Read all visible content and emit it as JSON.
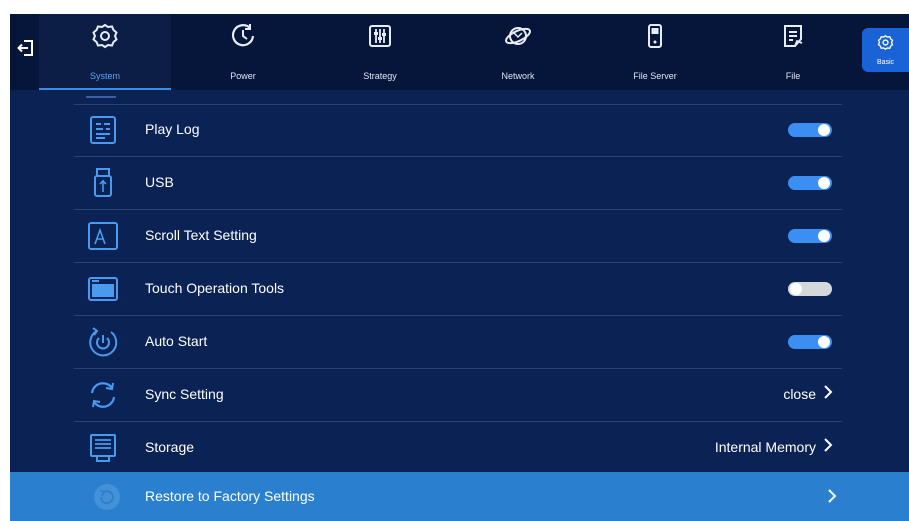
{
  "nav": {
    "tabs": [
      {
        "label": "System",
        "icon": "gear-icon",
        "active": true
      },
      {
        "label": "Power",
        "icon": "power-clock-icon",
        "active": false
      },
      {
        "label": "Strategy",
        "icon": "sliders-icon",
        "active": false
      },
      {
        "label": "Network",
        "icon": "globe-icon",
        "active": false
      },
      {
        "label": "File Server",
        "icon": "server-icon",
        "active": false
      },
      {
        "label": "File",
        "icon": "document-icon",
        "active": false
      }
    ],
    "basic_label": "Basic"
  },
  "settings": {
    "rows": [
      {
        "label": "Play Log",
        "icon": "log-icon",
        "toggle": "on"
      },
      {
        "label": "USB",
        "icon": "usb-icon",
        "toggle": "on"
      },
      {
        "label": "Scroll Text Setting",
        "icon": "text-icon",
        "toggle": "on"
      },
      {
        "label": "Touch Operation Tools",
        "icon": "touch-tools-icon",
        "toggle": "off"
      },
      {
        "label": "Auto Start",
        "icon": "auto-start-icon",
        "toggle": "on"
      },
      {
        "label": "Sync Setting",
        "icon": "sync-icon",
        "value": "close"
      },
      {
        "label": "Storage",
        "icon": "storage-icon",
        "value": "Internal Memory"
      }
    ],
    "restore": {
      "label": "Restore to Factory Settings",
      "icon": "restore-icon"
    }
  },
  "colors": {
    "background": "#0b2255",
    "nav_background": "#06153a",
    "accent": "#3c8ff2",
    "highlight_row": "#2a80cf"
  }
}
